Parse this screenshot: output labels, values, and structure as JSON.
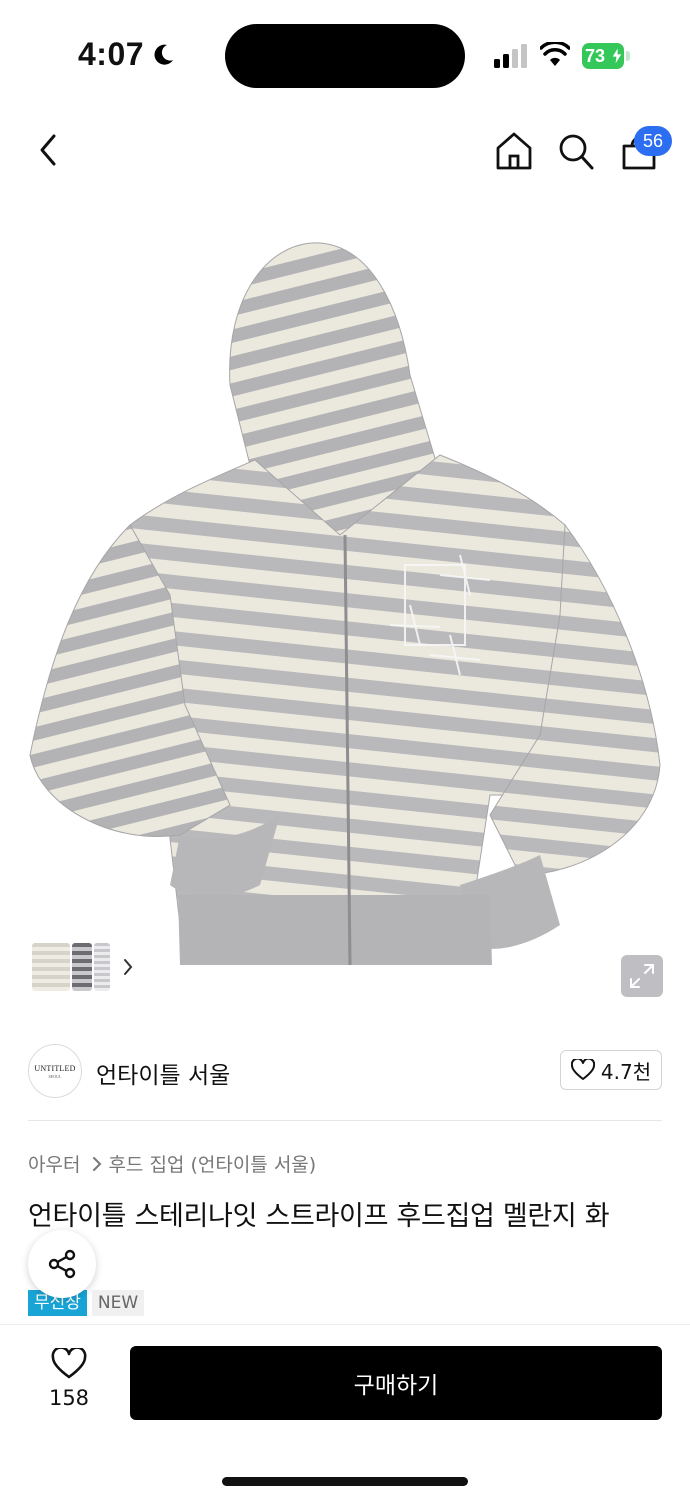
{
  "status_bar": {
    "time": "4:07",
    "battery": "73"
  },
  "nav": {
    "cart_count": "56"
  },
  "product_image": {
    "alt": "Striped zip-up hoodie"
  },
  "brand": {
    "logo_line1": "UNTITLED",
    "logo_line2": "SEOUL",
    "name": "언타이틀 서울",
    "likes": "4.7천"
  },
  "breadcrumb": {
    "category": "아우터",
    "subcategory": "후드 집업 (언타이틀 서울)"
  },
  "product": {
    "title": "언타이틀 스테리나잇 스트라이프 후드집업 멜란지 화"
  },
  "tags": [
    "무신장",
    "NEW"
  ],
  "bottom_bar": {
    "like_count": "158",
    "buy_label": "구매하기"
  },
  "colors": {
    "accent_blue": "#2b6ef2",
    "tag_blue": "#18a5d6",
    "battery_green": "#34c759"
  },
  "icons": [
    "back-icon",
    "home-icon",
    "search-icon",
    "bag-icon",
    "expand-icon",
    "heart-icon",
    "share-icon",
    "chevron-right-icon"
  ]
}
